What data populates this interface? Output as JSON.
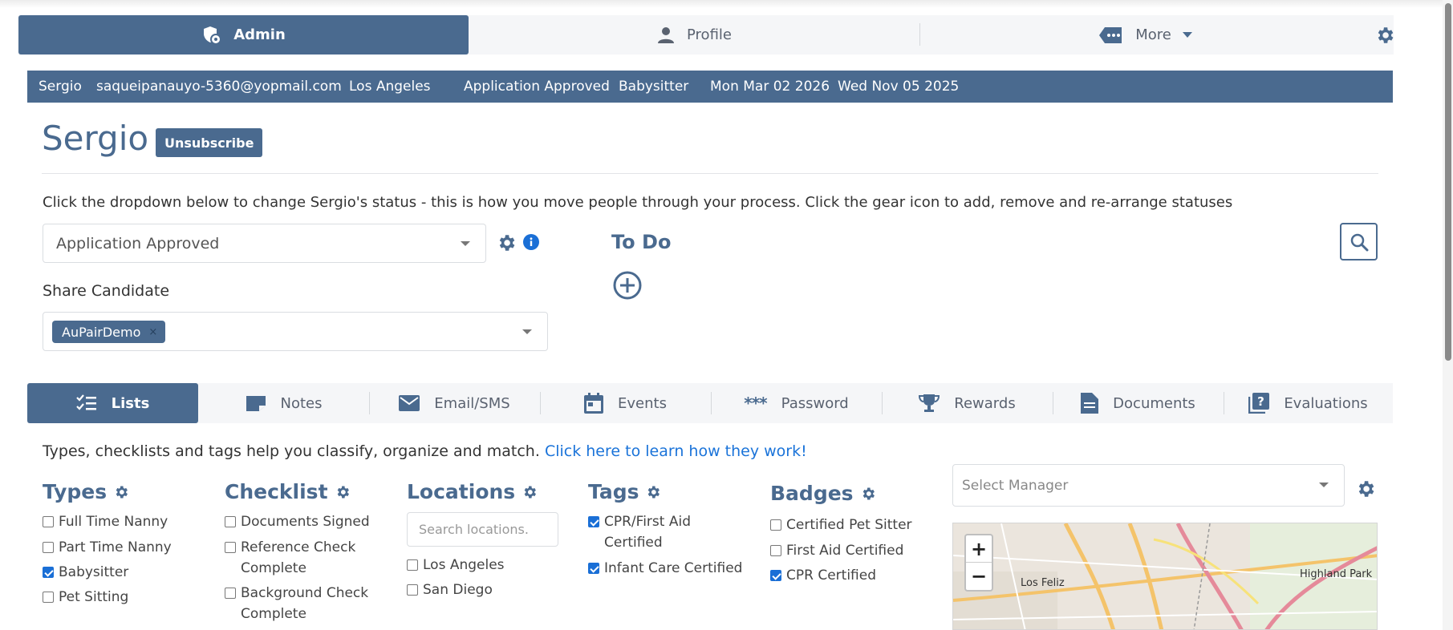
{
  "topnav": {
    "tabs": [
      {
        "label": "Admin",
        "icon": "shield-gear-icon",
        "active": true
      },
      {
        "label": "Profile",
        "icon": "person-icon",
        "active": false
      },
      {
        "label": "More",
        "icon": "tag-dots-icon",
        "active": false
      }
    ]
  },
  "infobar": {
    "name": "Sergio",
    "email": "saqueipanauyo-5360@yopmail.com",
    "city": "Los Angeles",
    "status": "Application Approved",
    "type": "Babysitter",
    "date1": "Mon Mar 02 2026",
    "date2": "Wed Nov 05 2025"
  },
  "profile": {
    "name": "Sergio",
    "unsubscribe_label": "Unsubscribe"
  },
  "status": {
    "help": "Click the dropdown below to change Sergio's status - this is how you move people through your process. Click the gear icon to add, remove and re-arrange statuses",
    "selected": "Application Approved"
  },
  "share": {
    "label": "Share Candidate",
    "chip": "AuPairDemo",
    "chip_remove": "×"
  },
  "todo": {
    "title": "To Do"
  },
  "section_tabs": [
    {
      "label": "Lists",
      "icon": "checklist-icon",
      "active": true
    },
    {
      "label": "Notes",
      "icon": "note-icon",
      "active": false
    },
    {
      "label": "Email/SMS",
      "icon": "envelope-icon",
      "active": false
    },
    {
      "label": "Events",
      "icon": "calendar-icon",
      "active": false
    },
    {
      "label": "Password",
      "icon": "asterisks-icon",
      "active": false
    },
    {
      "label": "Rewards",
      "icon": "trophy-icon",
      "active": false
    },
    {
      "label": "Documents",
      "icon": "document-icon",
      "active": false
    },
    {
      "label": "Evaluations",
      "icon": "question-book-icon",
      "active": false
    }
  ],
  "lists": {
    "help": "Types, checklists and tags help you classify, organize and match.",
    "help_link": "Click here to learn how they work!",
    "types": {
      "title": "Types",
      "items": [
        {
          "label": "Full Time Nanny",
          "checked": false
        },
        {
          "label": "Part Time Nanny",
          "checked": false
        },
        {
          "label": "Babysitter",
          "checked": true
        },
        {
          "label": "Pet Sitting",
          "checked": false
        }
      ]
    },
    "checklist": {
      "title": "Checklist",
      "items": [
        {
          "label": "Documents Signed",
          "checked": false
        },
        {
          "label": "Reference Check Complete",
          "checked": false
        },
        {
          "label": "Background Check Complete",
          "checked": false
        }
      ]
    },
    "locations": {
      "title": "Locations",
      "search_placeholder": "Search locations.",
      "items": [
        {
          "label": "Los Angeles",
          "checked": false
        },
        {
          "label": "San Diego",
          "checked": false
        }
      ]
    },
    "tags": {
      "title": "Tags",
      "items": [
        {
          "label": "CPR/First Aid Certified",
          "checked": true
        },
        {
          "label": "Infant Care Certified",
          "checked": true
        }
      ]
    },
    "badges": {
      "title": "Badges",
      "items": [
        {
          "label": "Certified Pet Sitter",
          "checked": false
        },
        {
          "label": "First Aid Certified",
          "checked": false
        },
        {
          "label": "CPR Certified",
          "checked": true
        }
      ]
    },
    "manager_placeholder": "Select Manager"
  },
  "map": {
    "zoom_in": "+",
    "zoom_out": "−",
    "labels": [
      "Los Feliz",
      "Highland Park"
    ]
  },
  "colors": {
    "primary": "#4a6a8f",
    "link": "#1a73d9",
    "info": "#1a6fd6"
  }
}
